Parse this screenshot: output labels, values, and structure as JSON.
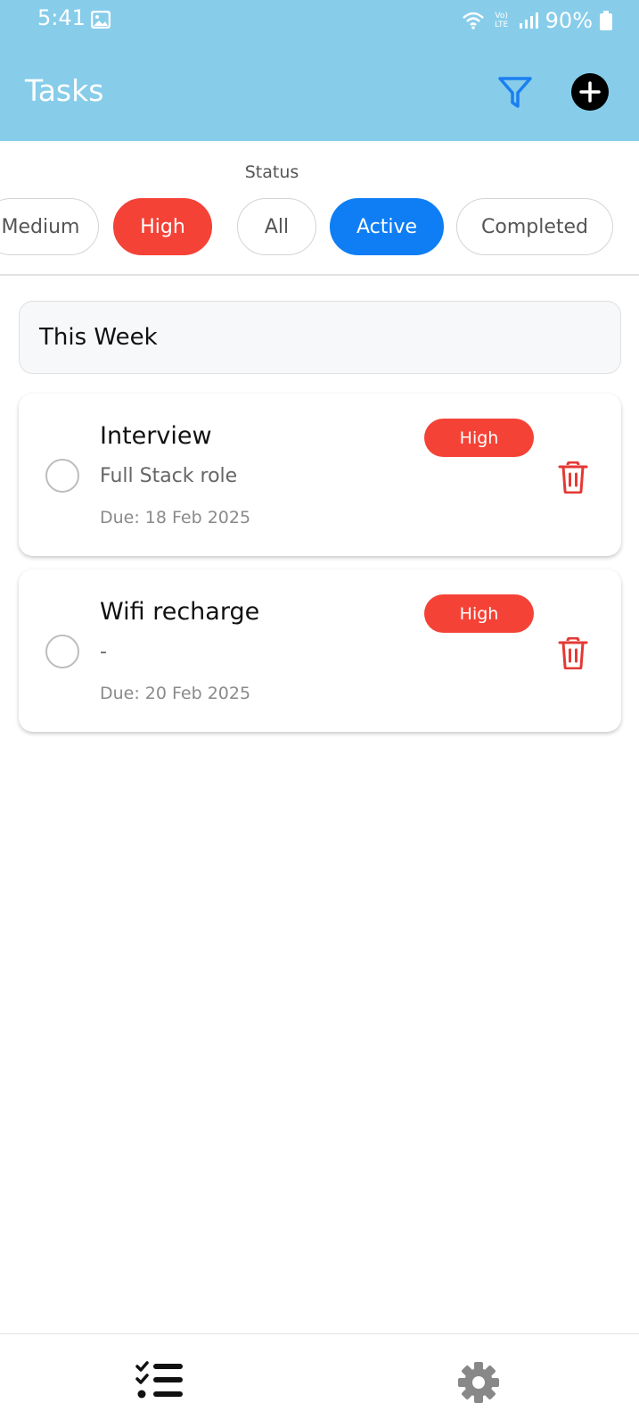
{
  "status_bar": {
    "time": "5:41",
    "network": "Vo) LTE",
    "battery": "90%"
  },
  "app_bar": {
    "title": "Tasks",
    "filter_icon": "filter-icon",
    "add_icon": "plus-circle-icon"
  },
  "filters": {
    "status_label": "Status",
    "chips": [
      {
        "label": "Medium",
        "state": "unselected"
      },
      {
        "label": "High",
        "state": "selected-red"
      },
      {
        "label": "All",
        "state": "unselected"
      },
      {
        "label": "Active",
        "state": "selected-blue"
      },
      {
        "label": "Completed",
        "state": "unselected"
      }
    ]
  },
  "section": {
    "title": "This Week"
  },
  "tasks": [
    {
      "title": "Interview",
      "description": "Full Stack role",
      "due": "Due: 18 Feb 2025",
      "priority": "High",
      "completed": false
    },
    {
      "title": "Wifi recharge",
      "description": "-",
      "due": "Due: 20 Feb 2025",
      "priority": "High",
      "completed": false
    }
  ],
  "bottom_nav": {
    "items": [
      "tasks-list-icon",
      "settings-gear-icon"
    ]
  },
  "colors": {
    "app_bar": "#87cdea",
    "high_priority": "#f44236",
    "active_chip": "#0f7ef5",
    "filter_icon": "#1a7ff0",
    "trash": "#e53935"
  }
}
